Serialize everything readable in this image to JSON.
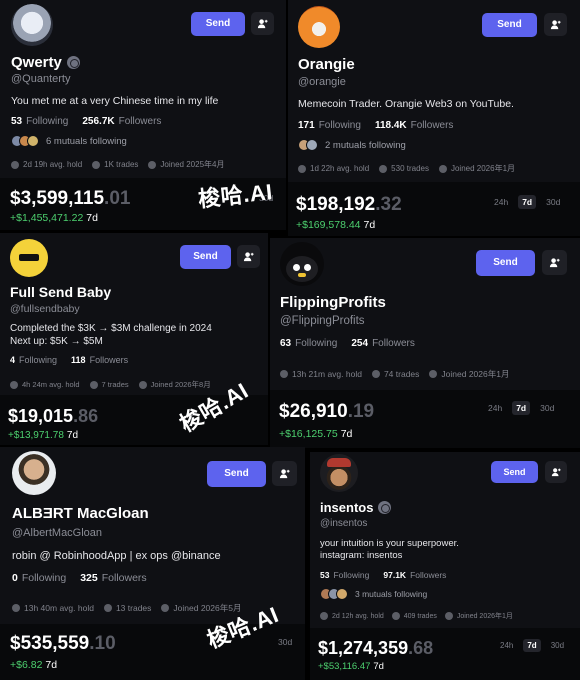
{
  "cards": [
    {
      "name": "Qwerty",
      "handle": "@Quanterty",
      "verified": true,
      "bio": [
        "You met me at a very Chinese time in my life"
      ],
      "following": "53",
      "followers": "256.7K",
      "following_label": "Following",
      "followers_label": "Followers",
      "mutuals": "6 mutuals following",
      "hold": "2d 19h avg. hold",
      "trades": "1K trades",
      "joined": "Joined 2025年4月",
      "value_main": "$3,599,115",
      "value_cents": ".01",
      "change": "+$1,455,471.22",
      "period": "7d",
      "send_label": "Send"
    },
    {
      "name": "Orangie",
      "handle": "@orangie",
      "verified": false,
      "bio": [
        "Memecoin Trader. Orangie Web3 on YouTube."
      ],
      "following": "171",
      "followers": "118.4K",
      "following_label": "Following",
      "followers_label": "Followers",
      "mutuals": "2 mutuals following",
      "hold": "1d 22h avg. hold",
      "trades": "530 trades",
      "joined": "Joined 2026年1月",
      "value_main": "$198,192",
      "value_cents": ".32",
      "change": "+$169,578.44",
      "period": "7d",
      "ranges": [
        "24h",
        "7d",
        "30d"
      ],
      "send_label": "Send"
    },
    {
      "name": "Full Send Baby",
      "handle": "@fullsendbaby",
      "verified": false,
      "bio": [
        "Completed the $3K → $3M challenge in 2024",
        "Next up: $5K → $5M"
      ],
      "following": "4",
      "followers": "118",
      "following_label": "Following",
      "followers_label": "Followers",
      "hold": "4h 24m avg. hold",
      "trades": "7 trades",
      "joined": "Joined 2026年8月",
      "value_main": "$19,015",
      "value_cents": ".86",
      "change": "+$13,971.78",
      "period": "7d",
      "send_label": "Send"
    },
    {
      "name": "FlippingProfits",
      "handle": "@FlippingProfits",
      "verified": false,
      "following": "63",
      "followers": "254",
      "following_label": "Following",
      "followers_label": "Followers",
      "hold": "13h 21m avg. hold",
      "trades": "74 trades",
      "joined": "Joined 2026年1月",
      "value_main": "$26,910",
      "value_cents": ".19",
      "change": "+$16,125.75",
      "period": "7d",
      "ranges": [
        "24h",
        "7d",
        "30d"
      ],
      "send_label": "Send"
    },
    {
      "name": "ALBƎRT MacGloan",
      "handle": "@AlbertMacGloan",
      "verified": false,
      "bio": [
        "robin @ RobinhoodApp  | ex ops @binance"
      ],
      "following": "0",
      "followers": "325",
      "following_label": "Following",
      "followers_label": "Followers",
      "hold": "13h 40m avg. hold",
      "trades": "13 trades",
      "joined": "Joined 2026年5月",
      "value_main": "$535,559",
      "value_cents": ".10",
      "change": "+$6.82",
      "period": "7d",
      "ranges": [
        "30d"
      ],
      "send_label": "Send"
    },
    {
      "name": "insentos",
      "handle": "@insentos",
      "verified": true,
      "bio": [
        "your intuition is your superpower.",
        "instagram: insentos"
      ],
      "following": "53",
      "followers": "97.1K",
      "following_label": "Following",
      "followers_label": "Followers",
      "mutuals": "3 mutuals following",
      "hold": "2d 12h avg. hold",
      "trades": "409 trades",
      "joined": "Joined 2026年1月",
      "value_main": "$1,274,359",
      "value_cents": ".68",
      "change": "+$53,116.47",
      "period": "7d",
      "ranges": [
        "24h",
        "7d",
        "30d"
      ],
      "send_label": "Send"
    }
  ],
  "partial_ranges": {
    "card1": "30d",
    "card3": "2"
  },
  "watermark": "梭哈.AI",
  "colors": {
    "accent": "#5d63ee",
    "positive": "#4dd06f",
    "card_bg": "#0f1014"
  }
}
